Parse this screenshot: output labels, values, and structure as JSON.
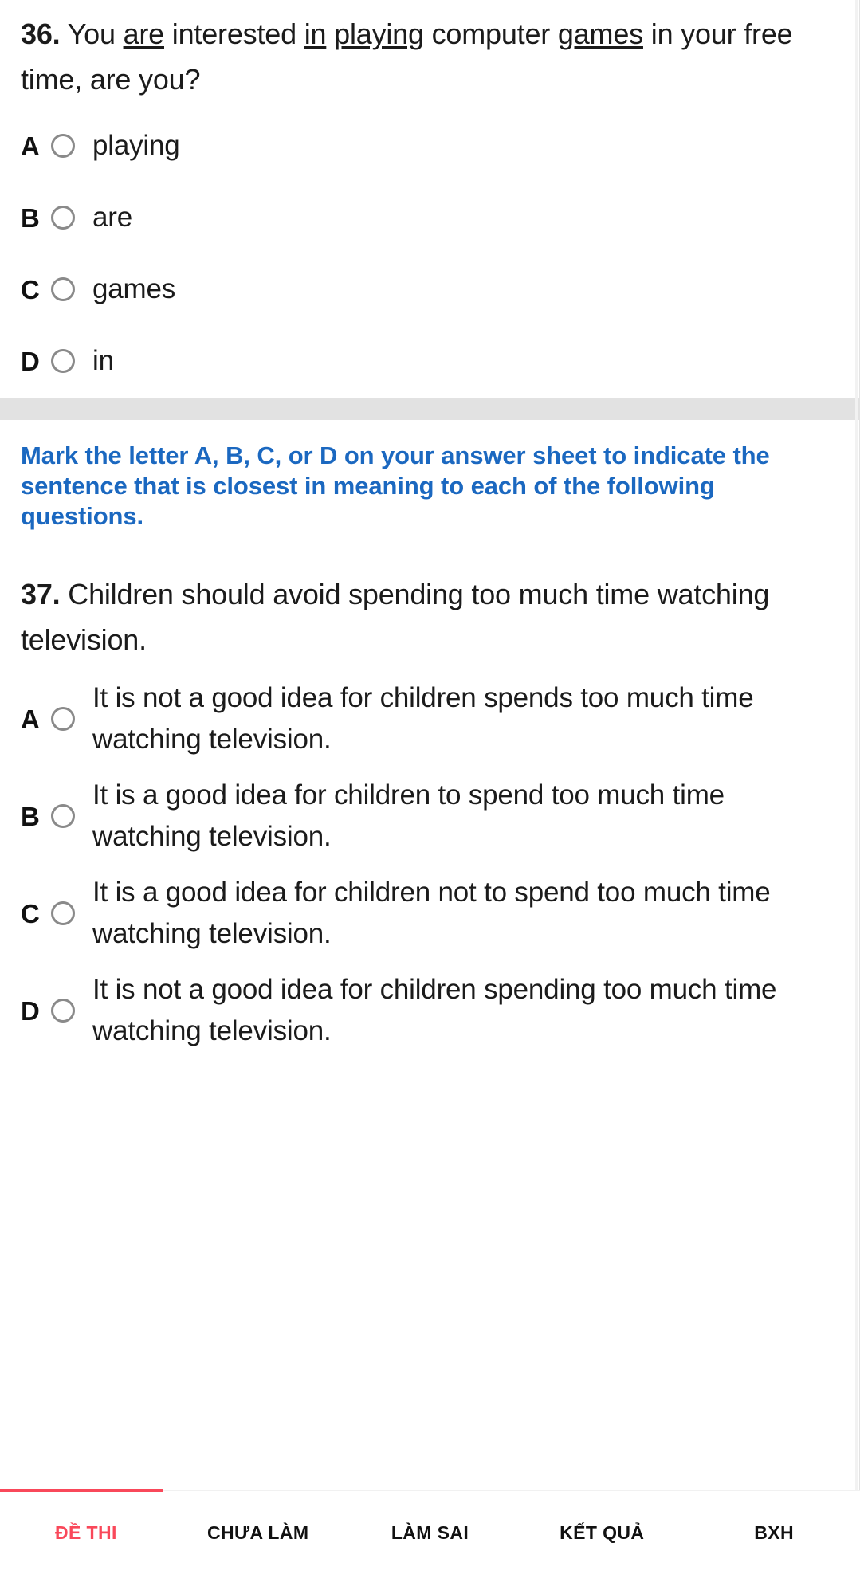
{
  "colors": {
    "accent_red": "#f9485a",
    "instruction_blue": "#1b68c0",
    "text": "#1b1b1b",
    "radio_outline": "#8a8a8a",
    "section_divider": "#e2e2e2"
  },
  "questions": [
    {
      "number": "36.",
      "stem_parts": [
        {
          "text": "You ",
          "underline": false
        },
        {
          "text": "are",
          "underline": true
        },
        {
          "text": " interested ",
          "underline": false
        },
        {
          "text": "in",
          "underline": true
        },
        {
          "text": " ",
          "underline": false
        },
        {
          "text": "playing",
          "underline": true
        },
        {
          "text": " computer ",
          "underline": false
        },
        {
          "text": "games",
          "underline": true
        },
        {
          "text": " in your free time, are you?",
          "underline": false
        }
      ],
      "options": [
        {
          "letter": "A",
          "text": "playing"
        },
        {
          "letter": "B",
          "text": "are"
        },
        {
          "letter": "C",
          "text": "games"
        },
        {
          "letter": "D",
          "text": "in"
        }
      ]
    },
    {
      "number": "37.",
      "stem_parts": [
        {
          "text": "Children should avoid spending too much time watching television.",
          "underline": false
        }
      ],
      "options": [
        {
          "letter": "A",
          "text": "It is not a good idea for children spends too much time watching television."
        },
        {
          "letter": "B",
          "text": "It is a good idea for children to spend too much time watching television."
        },
        {
          "letter": "C",
          "text": "It is a good idea for children not to spend too much time watching television."
        },
        {
          "letter": "D",
          "text": "It is not a good idea for children spending too much time watching television."
        }
      ]
    }
  ],
  "instruction": {
    "text": "Mark the letter A, B, C, or D on your answer sheet to indicate the sentence that is closest in meaning to each of the following questions."
  },
  "tabbar": {
    "tabs": [
      {
        "label": "ĐỀ THI",
        "active": true
      },
      {
        "label": "CHƯA LÀM",
        "active": false
      },
      {
        "label": "LÀM SAI",
        "active": false
      },
      {
        "label": "KẾT QUẢ",
        "active": false
      },
      {
        "label": "BXH",
        "active": false
      }
    ]
  }
}
